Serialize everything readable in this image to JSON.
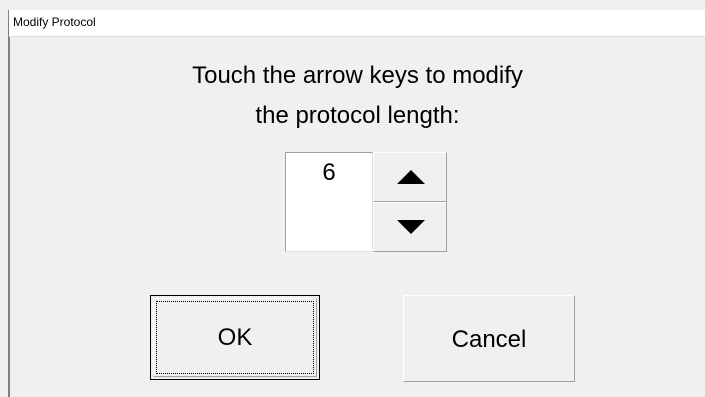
{
  "window": {
    "title": "Modify Protocol"
  },
  "prompt": {
    "line1": "Touch the arrow keys to modify",
    "line2": "the protocol length:"
  },
  "length": {
    "value": "6",
    "increase_icon": "up-triangle",
    "decrease_icon": "down-triangle"
  },
  "buttons": {
    "ok_label": "OK",
    "cancel_label": "Cancel"
  },
  "colors": {
    "dialog_bg": "#f0f0f0",
    "titlebar_bg": "#ffffff",
    "text": "#000000"
  }
}
